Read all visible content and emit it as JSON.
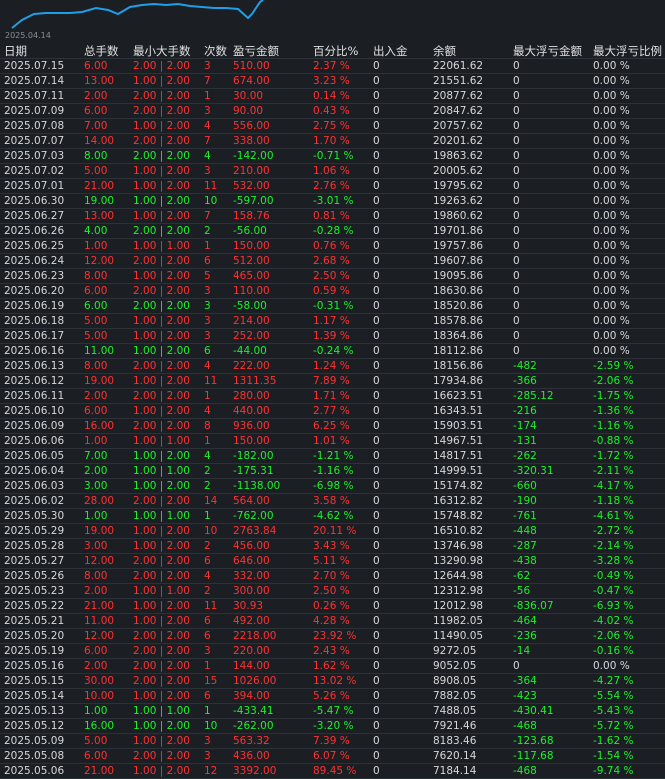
{
  "chart": {
    "date_label": "2025.04.14",
    "line_color": "#1f9fe6"
  },
  "table": {
    "headers": [
      "日期",
      "总手数",
      "最小大手数",
      "次数",
      "盈亏金额",
      "百分比%",
      "出入金",
      "余额",
      "最大浮亏金额",
      "最大浮亏比例"
    ],
    "rows": [
      [
        "2025.07.15",
        "6.00",
        "2.00 | 2.00",
        "3",
        "510.00",
        "2.37 %",
        "0",
        "22061.62",
        "0",
        "0.00 %"
      ],
      [
        "2025.07.14",
        "13.00",
        "1.00 | 2.00",
        "7",
        "674.00",
        "3.23 %",
        "0",
        "21551.62",
        "0",
        "0.00 %"
      ],
      [
        "2025.07.11",
        "2.00",
        "2.00 | 2.00",
        "1",
        "30.00",
        "0.14 %",
        "0",
        "20877.62",
        "0",
        "0.00 %"
      ],
      [
        "2025.07.09",
        "6.00",
        "2.00 | 2.00",
        "3",
        "90.00",
        "0.43 %",
        "0",
        "20847.62",
        "0",
        "0.00 %"
      ],
      [
        "2025.07.08",
        "7.00",
        "1.00 | 2.00",
        "4",
        "556.00",
        "2.75 %",
        "0",
        "20757.62",
        "0",
        "0.00 %"
      ],
      [
        "2025.07.07",
        "14.00",
        "2.00 | 2.00",
        "7",
        "338.00",
        "1.70 %",
        "0",
        "20201.62",
        "0",
        "0.00 %"
      ],
      [
        "2025.07.03",
        "8.00",
        "2.00 | 2.00",
        "4",
        "-142.00",
        "-0.71 %",
        "0",
        "19863.62",
        "0",
        "0.00 %"
      ],
      [
        "2025.07.02",
        "5.00",
        "1.00 | 2.00",
        "3",
        "210.00",
        "1.06 %",
        "0",
        "20005.62",
        "0",
        "0.00 %"
      ],
      [
        "2025.07.01",
        "21.00",
        "1.00 | 2.00",
        "11",
        "532.00",
        "2.76 %",
        "0",
        "19795.62",
        "0",
        "0.00 %"
      ],
      [
        "2025.06.30",
        "19.00",
        "1.00 | 2.00",
        "10",
        "-597.00",
        "-3.01 %",
        "0",
        "19263.62",
        "0",
        "0.00 %"
      ],
      [
        "2025.06.27",
        "13.00",
        "1.00 | 2.00",
        "7",
        "158.76",
        "0.81 %",
        "0",
        "19860.62",
        "0",
        "0.00 %"
      ],
      [
        "2025.06.26",
        "4.00",
        "2.00 | 2.00",
        "2",
        "-56.00",
        "-0.28 %",
        "0",
        "19701.86",
        "0",
        "0.00 %"
      ],
      [
        "2025.06.25",
        "1.00",
        "1.00 | 1.00",
        "1",
        "150.00",
        "0.76 %",
        "0",
        "19757.86",
        "0",
        "0.00 %"
      ],
      [
        "2025.06.24",
        "12.00",
        "2.00 | 2.00",
        "6",
        "512.00",
        "2.68 %",
        "0",
        "19607.86",
        "0",
        "0.00 %"
      ],
      [
        "2025.06.23",
        "8.00",
        "1.00 | 2.00",
        "5",
        "465.00",
        "2.50 %",
        "0",
        "19095.86",
        "0",
        "0.00 %"
      ],
      [
        "2025.06.20",
        "6.00",
        "2.00 | 2.00",
        "3",
        "110.00",
        "0.59 %",
        "0",
        "18630.86",
        "0",
        "0.00 %"
      ],
      [
        "2025.06.19",
        "6.00",
        "2.00 | 2.00",
        "3",
        "-58.00",
        "-0.31 %",
        "0",
        "18520.86",
        "0",
        "0.00 %"
      ],
      [
        "2025.06.18",
        "5.00",
        "1.00 | 2.00",
        "3",
        "214.00",
        "1.17 %",
        "0",
        "18578.86",
        "0",
        "0.00 %"
      ],
      [
        "2025.06.17",
        "5.00",
        "1.00 | 2.00",
        "3",
        "252.00",
        "1.39 %",
        "0",
        "18364.86",
        "0",
        "0.00 %"
      ],
      [
        "2025.06.16",
        "11.00",
        "1.00 | 2.00",
        "6",
        "-44.00",
        "-0.24 %",
        "0",
        "18112.86",
        "0",
        "0.00 %"
      ],
      [
        "2025.06.13",
        "8.00",
        "2.00 | 2.00",
        "4",
        "222.00",
        "1.24 %",
        "0",
        "18156.86",
        "-482",
        "-2.59 %"
      ],
      [
        "2025.06.12",
        "19.00",
        "1.00 | 2.00",
        "11",
        "1311.35",
        "7.89 %",
        "0",
        "17934.86",
        "-366",
        "-2.06 %"
      ],
      [
        "2025.06.11",
        "2.00",
        "2.00 | 2.00",
        "1",
        "280.00",
        "1.71 %",
        "0",
        "16623.51",
        "-285.12",
        "-1.75 %"
      ],
      [
        "2025.06.10",
        "6.00",
        "1.00 | 2.00",
        "4",
        "440.00",
        "2.77 %",
        "0",
        "16343.51",
        "-216",
        "-1.36 %"
      ],
      [
        "2025.06.09",
        "16.00",
        "2.00 | 2.00",
        "8",
        "936.00",
        "6.25 %",
        "0",
        "15903.51",
        "-174",
        "-1.16 %"
      ],
      [
        "2025.06.06",
        "1.00",
        "1.00 | 1.00",
        "1",
        "150.00",
        "1.01 %",
        "0",
        "14967.51",
        "-131",
        "-0.88 %"
      ],
      [
        "2025.06.05",
        "7.00",
        "1.00 | 2.00",
        "4",
        "-182.00",
        "-1.21 %",
        "0",
        "14817.51",
        "-262",
        "-1.72 %"
      ],
      [
        "2025.06.04",
        "2.00",
        "1.00 | 1.00",
        "2",
        "-175.31",
        "-1.16 %",
        "0",
        "14999.51",
        "-320.31",
        "-2.11 %"
      ],
      [
        "2025.06.03",
        "3.00",
        "1.00 | 2.00",
        "2",
        "-1138.00",
        "-6.98 %",
        "0",
        "15174.82",
        "-660",
        "-4.17 %"
      ],
      [
        "2025.06.02",
        "28.00",
        "2.00 | 2.00",
        "14",
        "564.00",
        "3.58 %",
        "0",
        "16312.82",
        "-190",
        "-1.18 %"
      ],
      [
        "2025.05.30",
        "1.00",
        "1.00 | 1.00",
        "1",
        "-762.00",
        "-4.62 %",
        "0",
        "15748.82",
        "-761",
        "-4.61 %"
      ],
      [
        "2025.05.29",
        "19.00",
        "1.00 | 2.00",
        "10",
        "2763.84",
        "20.11 %",
        "0",
        "16510.82",
        "-448",
        "-2.72 %"
      ],
      [
        "2025.05.28",
        "3.00",
        "1.00 | 2.00",
        "2",
        "456.00",
        "3.43 %",
        "0",
        "13746.98",
        "-287",
        "-2.14 %"
      ],
      [
        "2025.05.27",
        "12.00",
        "2.00 | 2.00",
        "6",
        "646.00",
        "5.11 %",
        "0",
        "13290.98",
        "-438",
        "-3.28 %"
      ],
      [
        "2025.05.26",
        "8.00",
        "2.00 | 2.00",
        "4",
        "332.00",
        "2.70 %",
        "0",
        "12644.98",
        "-62",
        "-0.49 %"
      ],
      [
        "2025.05.23",
        "2.00",
        "1.00 | 1.00",
        "2",
        "300.00",
        "2.50 %",
        "0",
        "12312.98",
        "-56",
        "-0.47 %"
      ],
      [
        "2025.05.22",
        "21.00",
        "1.00 | 2.00",
        "11",
        "30.93",
        "0.26 %",
        "0",
        "12012.98",
        "-836.07",
        "-6.93 %"
      ],
      [
        "2025.05.21",
        "11.00",
        "1.00 | 2.00",
        "6",
        "492.00",
        "4.28 %",
        "0",
        "11982.05",
        "-464",
        "-4.02 %"
      ],
      [
        "2025.05.20",
        "12.00",
        "2.00 | 2.00",
        "6",
        "2218.00",
        "23.92 %",
        "0",
        "11490.05",
        "-236",
        "-2.06 %"
      ],
      [
        "2025.05.19",
        "6.00",
        "2.00 | 2.00",
        "3",
        "220.00",
        "2.43 %",
        "0",
        "9272.05",
        "-14",
        "-0.16 %"
      ],
      [
        "2025.05.16",
        "2.00",
        "2.00 | 2.00",
        "1",
        "144.00",
        "1.62 %",
        "0",
        "9052.05",
        "0",
        "0.00 %"
      ],
      [
        "2025.05.15",
        "30.00",
        "2.00 | 2.00",
        "15",
        "1026.00",
        "13.02 %",
        "0",
        "8908.05",
        "-364",
        "-4.27 %"
      ],
      [
        "2025.05.14",
        "10.00",
        "1.00 | 2.00",
        "6",
        "394.00",
        "5.26 %",
        "0",
        "7882.05",
        "-423",
        "-5.54 %"
      ],
      [
        "2025.05.13",
        "1.00",
        "1.00 | 1.00",
        "1",
        "-433.41",
        "-5.47 %",
        "0",
        "7488.05",
        "-430.41",
        "-5.43 %"
      ],
      [
        "2025.05.12",
        "16.00",
        "1.00 | 2.00",
        "10",
        "-262.00",
        "-3.20 %",
        "0",
        "7921.46",
        "-468",
        "-5.72 %"
      ],
      [
        "2025.05.09",
        "5.00",
        "1.00 | 2.00",
        "3",
        "563.32",
        "7.39 %",
        "0",
        "8183.46",
        "-123.68",
        "-1.62 %"
      ],
      [
        "2025.05.08",
        "6.00",
        "2.00 | 2.00",
        "3",
        "436.00",
        "6.07 %",
        "0",
        "7620.14",
        "-117.68",
        "-1.54 %"
      ],
      [
        "2025.05.06",
        "21.00",
        "1.00 | 2.00",
        "12",
        "3392.00",
        "89.45 %",
        "0",
        "7184.14",
        "-468",
        "-9.74 %"
      ]
    ]
  }
}
